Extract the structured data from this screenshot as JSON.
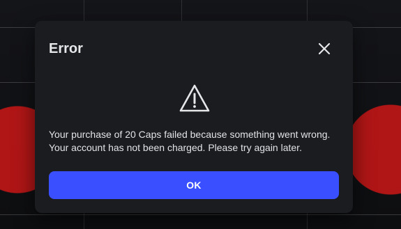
{
  "dialog": {
    "title": "Error",
    "message_line_1": "Your purchase of 20 Caps failed because something went wrong.",
    "message_line_2": "Your account has not been charged. Please try again later.",
    "ok_label": "OK",
    "icons": {
      "close": "close-icon",
      "warning": "warning-icon"
    }
  },
  "colors": {
    "dialog_bg": "#1b1c20",
    "ok_button": "#3a4fff",
    "backdrop": "#0b0c0e"
  }
}
